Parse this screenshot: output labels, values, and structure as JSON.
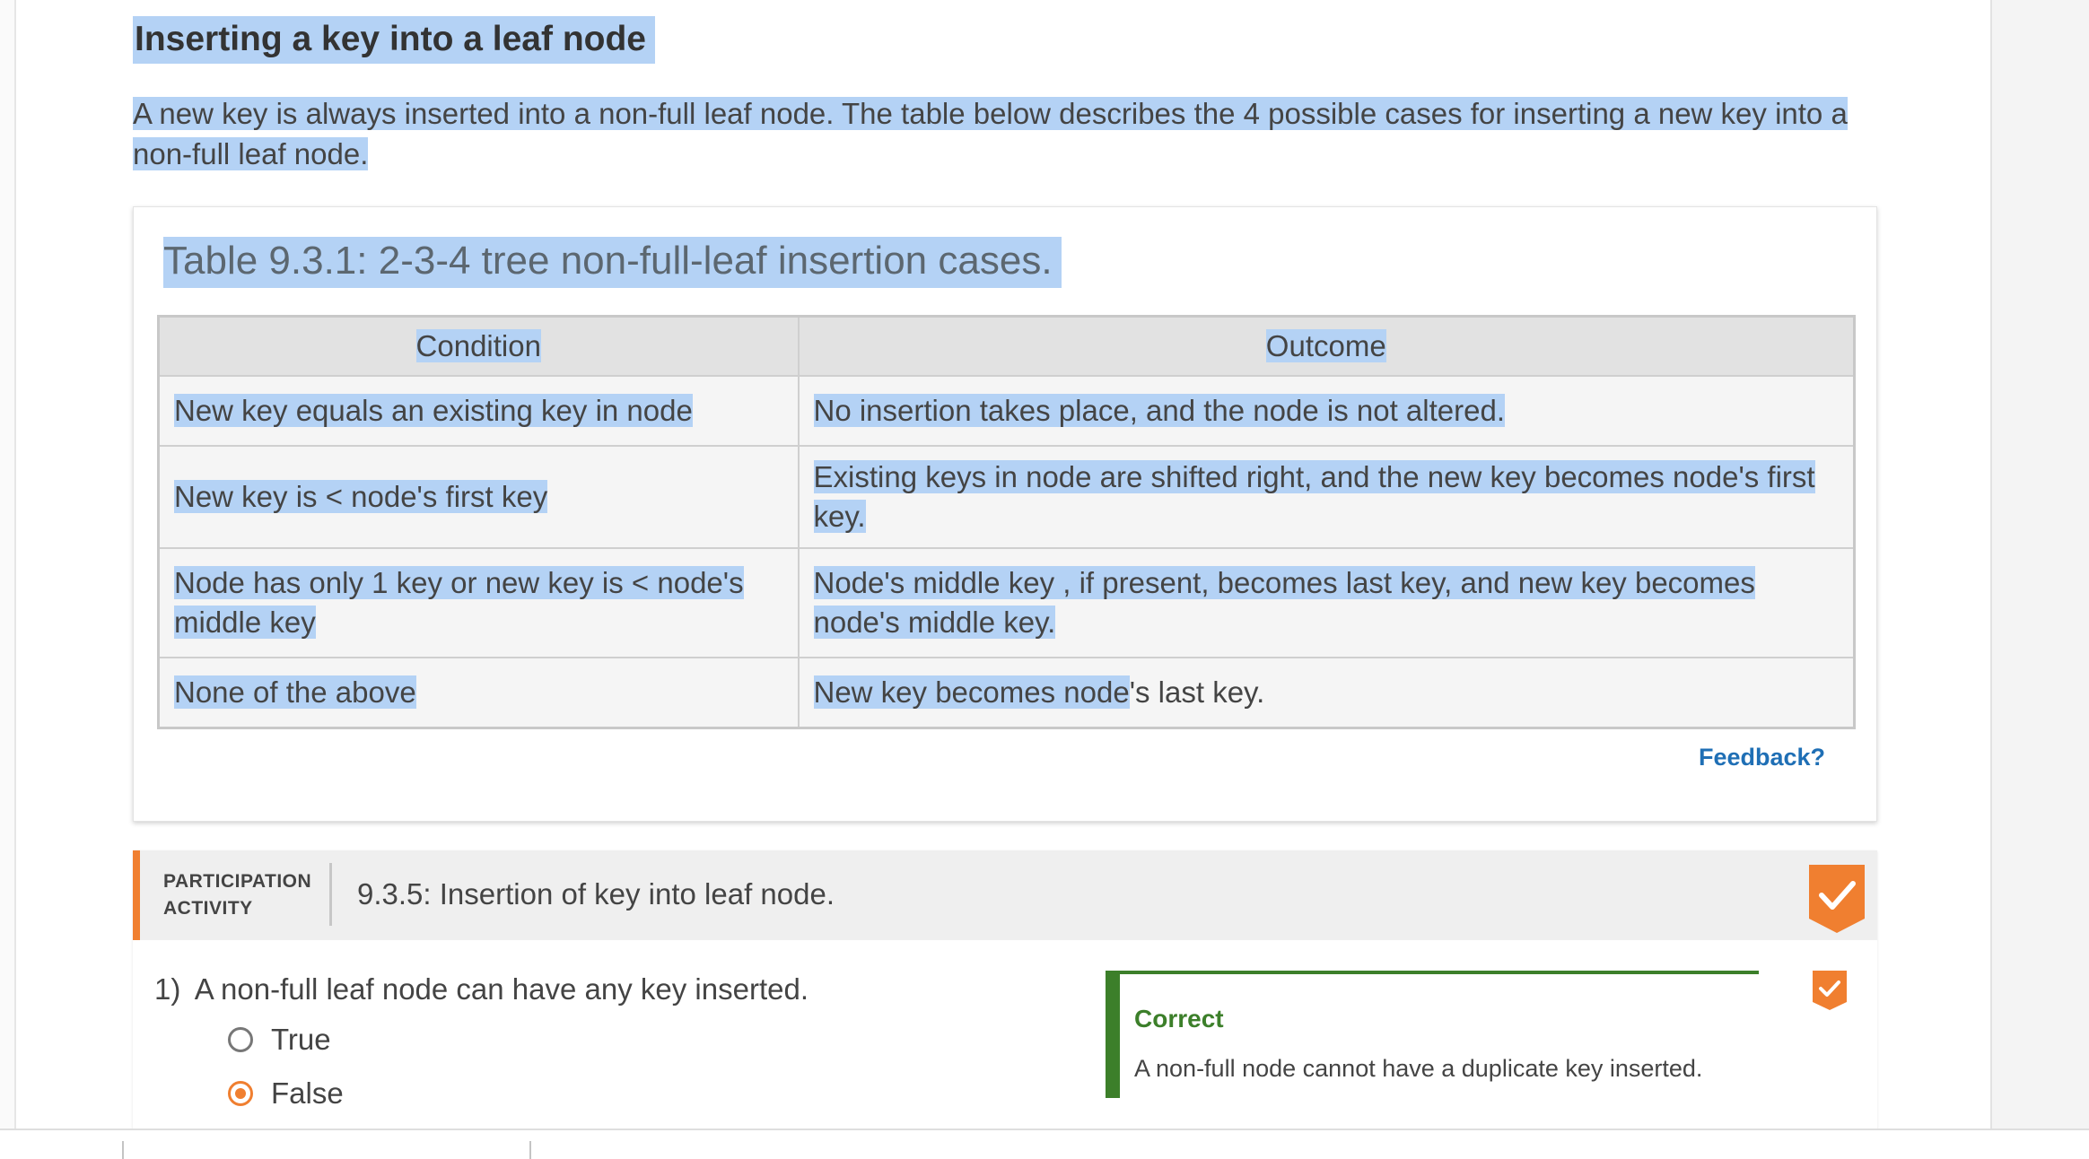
{
  "section": {
    "title": "Inserting a key into a leaf node",
    "intro": "A new key is always inserted into a non-full leaf node. The table below describes the 4 possible cases for inserting a new key into a non-full leaf node."
  },
  "table": {
    "caption": "Table 9.3.1: 2-3-4 tree non-full-leaf insertion cases.",
    "headers": [
      "Condition",
      "Outcome"
    ],
    "rows": [
      {
        "condition": "New key equals an existing key in node",
        "outcome": "No insertion takes place, and the node is not altered."
      },
      {
        "condition": "New key is < node's first key",
        "outcome": "Existing keys in node are shifted right, and the new key becomes node's first key."
      },
      {
        "condition": "Node has only 1 key or new key is < node's middle key",
        "outcome": "Node's middle key , if present, becomes last key, and new key becomes node's middle key."
      },
      {
        "condition": "None of the above",
        "outcome_selected": "New key becomes node",
        "outcome_rest": "'s last key."
      }
    ],
    "feedback_label": "Feedback?"
  },
  "activity": {
    "type_line1": "PARTICIPATION",
    "type_line2": "ACTIVITY",
    "title": "9.3.5: Insertion of key into leaf node.",
    "question": {
      "number": "1)",
      "text": "A non-full leaf node can have any key inserted.",
      "options": [
        "True",
        "False"
      ],
      "selected": "False"
    },
    "result": {
      "status": "Correct",
      "message": "A non-full node cannot have a duplicate key inserted."
    }
  },
  "colors": {
    "selection_highlight": "#b4d2f5",
    "accent_orange": "#f07f30",
    "correct_green": "#3c7f2a",
    "link_blue": "#1f6fb5"
  },
  "icons": {
    "completion": "checkmark-badge-icon",
    "question_status": "checkmark-badge-icon"
  }
}
